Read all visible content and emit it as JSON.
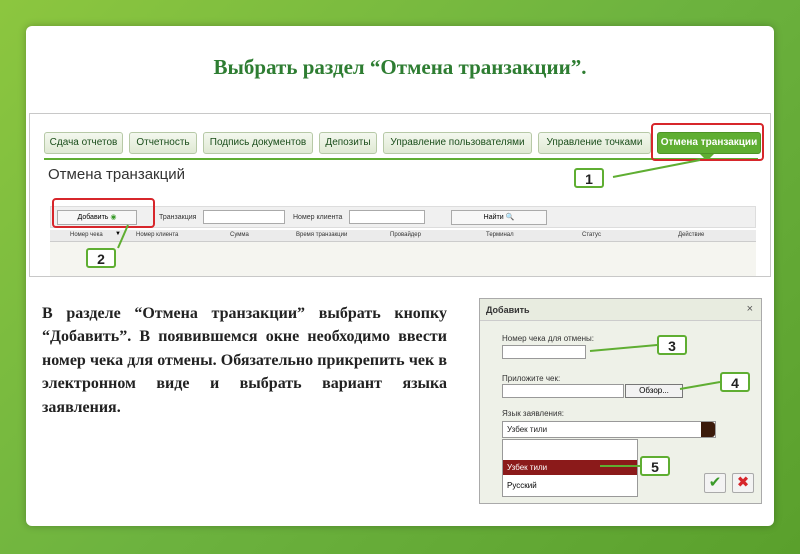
{
  "title": "Выбрать раздел “Отмена транзакции”.",
  "tabs": [
    {
      "label": "Сдача отчетов"
    },
    {
      "label": "Отчетность"
    },
    {
      "label": "Подпись документов"
    },
    {
      "label": "Депозиты"
    },
    {
      "label": "Управление пользователями"
    },
    {
      "label": "Управление точками"
    },
    {
      "label": "Отмена транзакции"
    }
  ],
  "page_heading": "Отмена транзакций",
  "filters": {
    "add_label": "Добавить",
    "transaction_label": "Транзакция",
    "client_label": "Номер клиента",
    "find_label": "Найти"
  },
  "table_headers": [
    "Номер чека",
    "Номер клиента",
    "Сумма",
    "Время транзакции",
    "Провайдер",
    "Терминал",
    "Статус",
    "Действие"
  ],
  "badges": [
    "1",
    "2",
    "3",
    "4",
    "5"
  ],
  "body_text": "В разделе “Отмена транзакции” выбрать кнопку “Добавить”. В появившемся окне необходимо ввести номер чека для отмены. Обязательно прикрепить чек в электронном виде и выбрать вариант языка заявления.",
  "dialog": {
    "title": "Добавить",
    "close": "×",
    "receipt_label": "Номер чека для отмены:",
    "attach_label": "Приложите чек:",
    "browse_label": "Обзор...",
    "language_label": "Язык заявления:",
    "language_value": "Узбек тили",
    "options": [
      "Узбек тили",
      "Русский"
    ]
  },
  "colors": {
    "accent_green": "#5fae32",
    "highlight_red": "#d7262b",
    "title_green": "#2e7d32"
  }
}
